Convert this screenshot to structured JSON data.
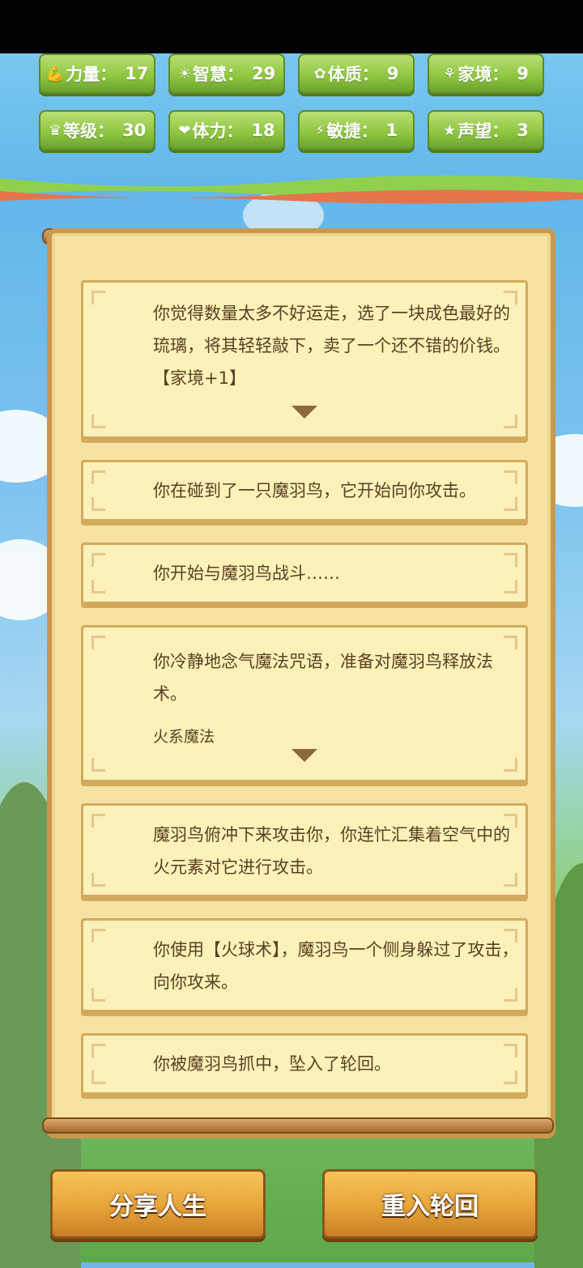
{
  "stats": [
    {
      "icon": "muscle-icon",
      "glyph": "💪",
      "label": "力量：",
      "value": "17"
    },
    {
      "icon": "bulb-icon",
      "glyph": "☀",
      "label": "智慧：",
      "value": "29"
    },
    {
      "icon": "body-icon",
      "glyph": "✿",
      "label": "体质：",
      "value": "9"
    },
    {
      "icon": "family-icon",
      "glyph": "⚘",
      "label": "家境：",
      "value": "9"
    },
    {
      "icon": "crown-icon",
      "glyph": "♛",
      "label": "等级：",
      "value": "30"
    },
    {
      "icon": "heart-icon",
      "glyph": "❤",
      "label": "体力：",
      "value": "18"
    },
    {
      "icon": "lightning-icon",
      "glyph": "⚡",
      "label": "敏捷：",
      "value": "1"
    },
    {
      "icon": "star-icon",
      "glyph": "★",
      "label": "声望：",
      "value": "3"
    }
  ],
  "events": [
    {
      "text": "你觉得数量太多不好运走，选了一块成色最好的琉璃，将其轻轻敲下，卖了一个还不错的价钱。【家境+1】"
    },
    {
      "text": "你在碰到了一只魔羽鸟，它开始向你攻击。"
    },
    {
      "text": "你开始与魔羽鸟战斗……"
    },
    {
      "text": "你冷静地念气魔法咒语，准备对魔羽鸟释放法术。",
      "sub": "火系魔法"
    },
    {
      "text": "魔羽鸟俯冲下来攻击你，你连忙汇集着空气中的火元素对它进行攻击。"
    },
    {
      "text": "你使用【火球术】，魔羽鸟一个侧身躲过了攻击，向你攻来。"
    },
    {
      "text": "你被魔羽鸟抓中，坠入了轮回。"
    }
  ],
  "buttons": {
    "share": "分享人生",
    "reincarnate": "重入轮回"
  }
}
